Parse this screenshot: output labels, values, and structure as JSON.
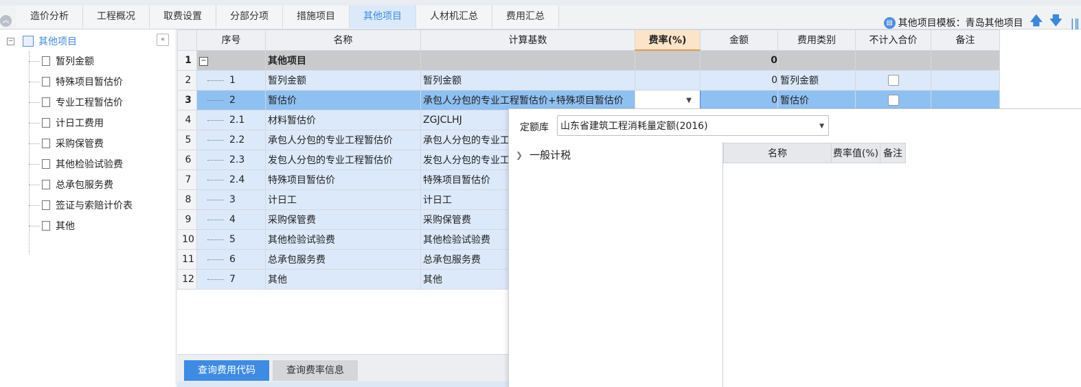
{
  "tabs": [
    "造价分析",
    "工程概况",
    "取费设置",
    "分部分项",
    "措施项目",
    "其他项目",
    "人材机汇总",
    "费用汇总"
  ],
  "active_tab": "其他项目",
  "template": {
    "label": "其他项目模板：青岛其他项目"
  },
  "tree": {
    "root": "其他项目",
    "items": [
      "暂列金额",
      "特殊项目暂估价",
      "专业工程暂估价",
      "计日工费用",
      "采购保管费",
      "其他检验试验费",
      "总承包服务费",
      "签证与索赔计价表",
      "其他"
    ]
  },
  "grid": {
    "headers": {
      "seq": "序号",
      "name": "名称",
      "base": "计算基数",
      "rate": "费率(%)",
      "amount": "金额",
      "category": "费用类别",
      "exclude": "不计入合价",
      "note": "备注"
    },
    "rows": [
      {
        "num": "1",
        "seq": "",
        "name": "其他项目",
        "base": "",
        "amount": "0",
        "category": ""
      },
      {
        "num": "2",
        "seq": "1",
        "name": "暂列金额",
        "base": "暂列金额",
        "amount": "0",
        "category": "暂列金额"
      },
      {
        "num": "3",
        "seq": "2",
        "name": "暂估价",
        "base": "承包人分包的专业工程暂估价+特殊项目暂估价",
        "amount": "0",
        "category": "暂估价"
      },
      {
        "num": "4",
        "seq": "2.1",
        "name": "材料暂估价",
        "base": "ZGJCLHJ",
        "amount": "",
        "category": ""
      },
      {
        "num": "5",
        "seq": "2.2",
        "name": "承包人分包的专业工程暂估价",
        "base": "承包人分包的专业工",
        "amount": "",
        "category": ""
      },
      {
        "num": "6",
        "seq": "2.3",
        "name": "发包人分包的专业工程暂估价",
        "base": "发包人分包的专业工",
        "amount": "",
        "category": ""
      },
      {
        "num": "7",
        "seq": "2.4",
        "name": "特殊项目暂估价",
        "base": "特殊项目暂估价",
        "amount": "",
        "category": ""
      },
      {
        "num": "8",
        "seq": "3",
        "name": "计日工",
        "base": "计日工",
        "amount": "",
        "category": ""
      },
      {
        "num": "9",
        "seq": "4",
        "name": "采购保管费",
        "base": "采购保管费",
        "amount": "",
        "category": ""
      },
      {
        "num": "10",
        "seq": "5",
        "name": "其他检验试验费",
        "base": "其他检验试验费",
        "amount": "",
        "category": ""
      },
      {
        "num": "11",
        "seq": "6",
        "name": "总承包服务费",
        "base": "总承包服务费",
        "amount": "",
        "category": ""
      },
      {
        "num": "12",
        "seq": "7",
        "name": "其他",
        "base": "其他",
        "amount": "",
        "category": ""
      }
    ]
  },
  "bottom_tabs": [
    "查询费用代码",
    "查询费率信息"
  ],
  "popup": {
    "quota_label": "定额库",
    "quota_value": "山东省建筑工程消耗量定额(2016)",
    "tree_item": "一般计税",
    "headers": [
      "名称",
      "费率值(%)",
      "备注"
    ]
  },
  "colors": {
    "accent": "#3d8be3",
    "selected_row": "#8fc0f2",
    "row_bg": "#dce9fa",
    "rate_header": "#fbe4c8"
  }
}
